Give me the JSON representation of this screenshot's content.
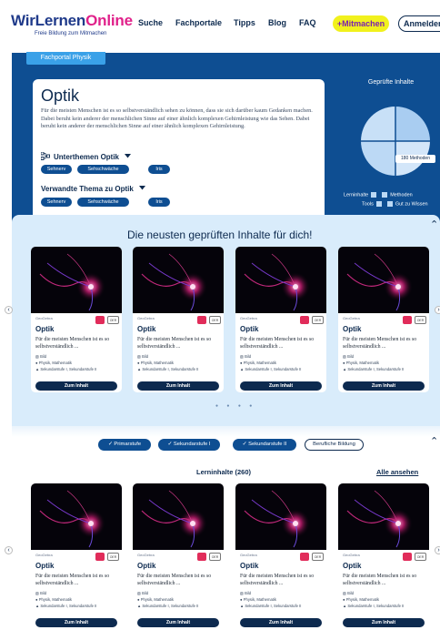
{
  "header": {
    "logo_main_a": "WirLernen",
    "logo_main_b": "Online",
    "logo_sub": "Freie Bildung zum Mitmachen",
    "nav": [
      "Suche",
      "Fachportale",
      "Tipps",
      "Blog",
      "FAQ"
    ],
    "mitmachen": "+Mitmachen",
    "anmelden": "Anmelden"
  },
  "hero": {
    "portal_tab": "Fachportal Physik",
    "title": "Optik",
    "description": "Für die meisten Menschen ist es so selbstverständlich sehen zu können, dass sie sich darüber kaum Gedanken machen. Dabei beruht kein anderer der menschlichen Sinne auf einer ähnlich komplexen Gehirnleistung wie das Sehen. Dabei beruht kein anderer der menschlichen Sinne auf einer ähnlich komplexen Gehirnleistung.",
    "subtopics_label": "Unterthemen Optik",
    "subtopics": [
      "Sehnerv",
      "Sehschwäche",
      "Iris"
    ],
    "related_label": "Verwandte Thema zu Optik",
    "related": [
      "Sehnerv",
      "Sehschwäche",
      "Iris"
    ],
    "checked_title": "Geprüfte Inhalte",
    "methods_tag": "180 Methoden",
    "legend": [
      "Lerninhalte",
      "Methoden",
      "Tools",
      "Gut zu Wissen"
    ]
  },
  "colors": {
    "brand_blue": "#0e4e92",
    "navy": "#0d2a4f",
    "tab_blue": "#3aa1e8",
    "mitmachen_yellow": "#f1f11d",
    "accent_pink": "#e0218a",
    "section_bg": "#d9ecfb"
  },
  "new_section": {
    "title": "Die neusten geprüften Inhalte für dich!"
  },
  "filters": [
    "Primarstufe",
    "Sekundarstufe I",
    "Sekundarstufe II",
    "Berufliche Bildung"
  ],
  "filter_active": [
    true,
    true,
    true,
    false
  ],
  "lerninhalte": {
    "title": "Lerninhalte (260)",
    "all_link": "Alle ansehen"
  },
  "card": {
    "source": "GeoGebra",
    "oer": "OER",
    "title": "Optik",
    "desc": "Für die meisten Menschen ist es so selbstverständlich ...",
    "type": "Bild",
    "subjects": "Physik, Mathematik",
    "levels": "Sekundarstufe I, Sekundarstufe II",
    "button": "Zum Inhalt"
  },
  "icons": {
    "dropdown": "caret-down-icon",
    "unterthemen": "sitemap-icon",
    "fav": "bookmark-icon",
    "prev": "chevron-left-icon",
    "next": "chevron-right-icon",
    "collapse": "chevron-up-icon"
  }
}
